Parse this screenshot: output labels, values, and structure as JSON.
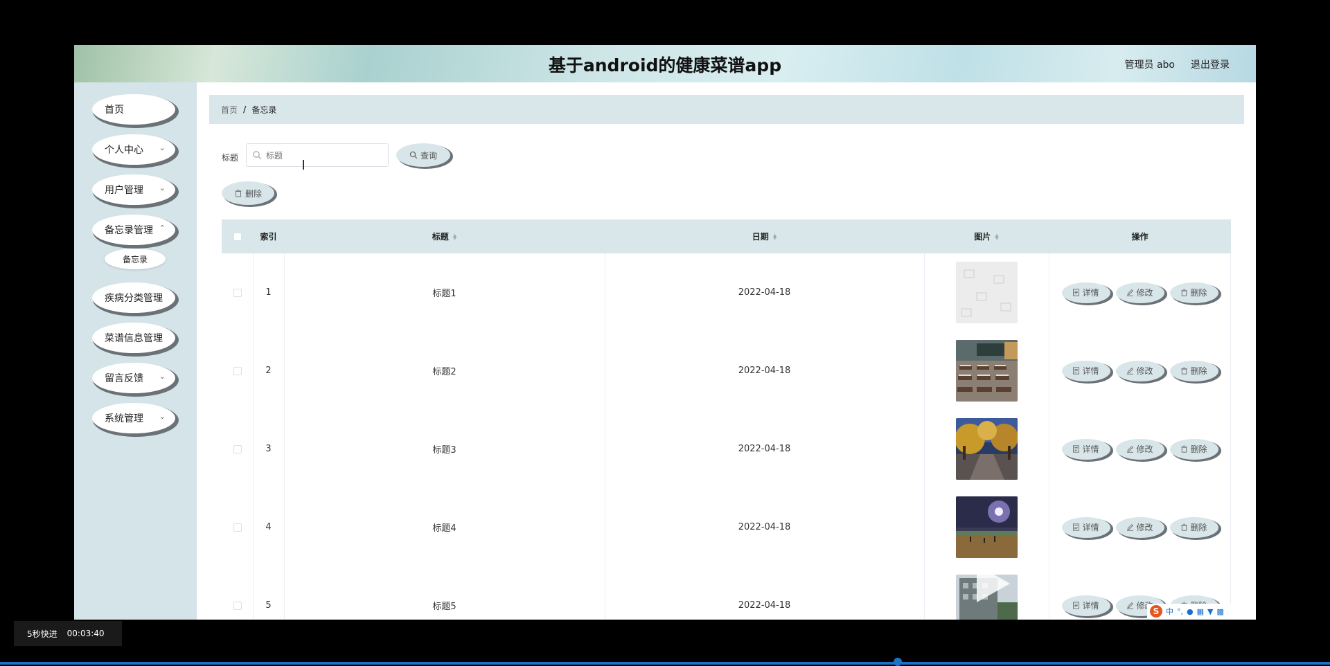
{
  "header": {
    "title": "基于android的健康菜谱app",
    "user": "管理员 abo",
    "logout": "退出登录"
  },
  "sidebar": {
    "items": [
      {
        "label": "首页",
        "has_arrow": false
      },
      {
        "label": "个人中心",
        "has_arrow": true
      },
      {
        "label": "用户管理",
        "has_arrow": true
      },
      {
        "label": "备忘录管理",
        "has_arrow": true
      },
      {
        "label": "疾病分类管理",
        "has_arrow": false
      },
      {
        "label": "菜谱信息管理",
        "has_arrow": false
      },
      {
        "label": "留言反馈",
        "has_arrow": true
      },
      {
        "label": "系统管理",
        "has_arrow": true
      }
    ],
    "submenu": {
      "label": "备忘录"
    }
  },
  "breadcrumb": {
    "home": "首页",
    "separator": "/",
    "current": "备忘录"
  },
  "filter": {
    "label": "标题",
    "placeholder": "标题",
    "search_button": "查询",
    "delete_button": "删除"
  },
  "table": {
    "headers": {
      "index": "索引",
      "title": "标题",
      "date": "日期",
      "image": "图片",
      "actions": "操作"
    },
    "rows": [
      {
        "index": "1",
        "title": "标题1",
        "date": "2022-04-18",
        "image": "placeholder"
      },
      {
        "index": "2",
        "title": "标题2",
        "date": "2022-04-18",
        "image": "classroom"
      },
      {
        "index": "3",
        "title": "标题3",
        "date": "2022-04-18",
        "image": "autumn-road"
      },
      {
        "index": "4",
        "title": "标题4",
        "date": "2022-04-18",
        "image": "night-plaza"
      },
      {
        "index": "5",
        "title": "标题5",
        "date": "2022-04-18",
        "image": "building"
      }
    ],
    "actions": {
      "detail": "详情",
      "edit": "修改",
      "delete": "删除"
    }
  },
  "player": {
    "skip_label": "5秒快进",
    "timestamp": "00:03:40"
  },
  "ime": {
    "logo": "S",
    "mode": "中"
  },
  "colors": {
    "sidebar_bg": "#d4e4e8",
    "header_bar_bg": "#d9e7ea",
    "button_bg": "#d8e5e9",
    "button_shadow": "#6b7277",
    "progress": "#1a73c8"
  }
}
